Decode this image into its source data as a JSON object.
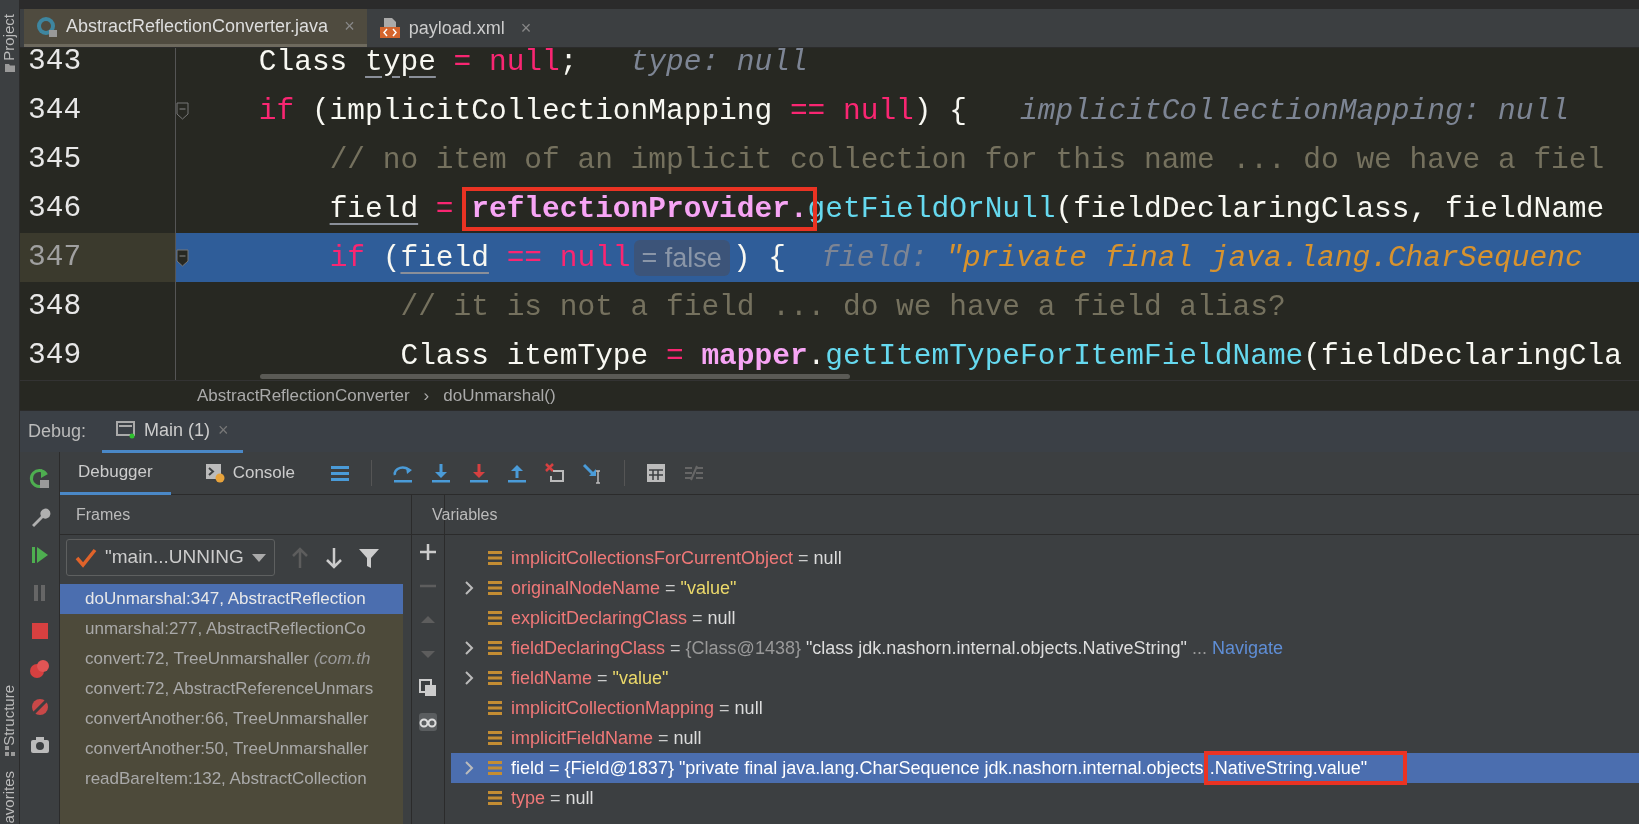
{
  "side_tabs": [
    {
      "label": "Project"
    },
    {
      "label": "Structure"
    },
    {
      "label": "avorites"
    }
  ],
  "editor_tabs": [
    {
      "label": "AbstractReflectionConverter.java",
      "kind": "java",
      "selected": true,
      "close": "×"
    },
    {
      "label": "payload.xml",
      "kind": "xml",
      "selected": false,
      "close": "×"
    }
  ],
  "code": {
    "lines": [
      {
        "number": "343",
        "current": false,
        "fold": false,
        "tokens": [
          {
            "text": "    Class ",
            "kind": "plain"
          },
          {
            "text": "type",
            "kind": "var"
          },
          {
            "text": " = ",
            "kind": "operator"
          },
          {
            "text": "null",
            "kind": "keyword"
          },
          {
            "text": ";   ",
            "kind": "plain"
          },
          {
            "text": "type: null",
            "kind": "hint"
          }
        ]
      },
      {
        "number": "344",
        "current": false,
        "fold": true,
        "tokens": [
          {
            "text": "    if",
            "kind": "keyword"
          },
          {
            "text": " (implicitCollectionMapping ",
            "kind": "plain"
          },
          {
            "text": "== ",
            "kind": "operator"
          },
          {
            "text": "null",
            "kind": "keyword"
          },
          {
            "text": ") {   ",
            "kind": "plain"
          },
          {
            "text": "implicitCollectionMapping: null",
            "kind": "hint"
          }
        ]
      },
      {
        "number": "345",
        "current": false,
        "fold": false,
        "tokens": [
          {
            "text": "        // no item of an implicit collection for this name ... do we have a fiel",
            "kind": "comment"
          }
        ]
      },
      {
        "number": "346",
        "current": false,
        "fold": false,
        "tokens": [
          {
            "text": "        field",
            "kind": "var"
          },
          {
            "text": " = ",
            "kind": "operator"
          },
          {
            "text": "reflectionProvider.",
            "kind": "member",
            "highlighted": true
          },
          {
            "text": "getFieldOrNull",
            "kind": "method"
          },
          {
            "text": "(fieldDeclaringClass, fieldName",
            "kind": "plain"
          }
        ]
      },
      {
        "number": "347",
        "current": true,
        "fold": true,
        "tokens": [
          {
            "text": "        if",
            "kind": "keyword"
          },
          {
            "text": " (",
            "kind": "plain"
          },
          {
            "text": "field",
            "kind": "var"
          },
          {
            "text": " == ",
            "kind": "operator"
          },
          {
            "text": "null",
            "kind": "keyword"
          },
          {
            "text": "= false",
            "kind": "inline_value"
          },
          {
            "text": ") {  ",
            "kind": "plain"
          },
          {
            "text": "field: ",
            "kind": "hint"
          },
          {
            "text": "\"private final java.lang.CharSequenc",
            "kind": "hint_value"
          }
        ]
      },
      {
        "number": "348",
        "current": false,
        "fold": false,
        "tokens": [
          {
            "text": "            // it is not a field ... do we have a field alias?",
            "kind": "comment"
          }
        ]
      },
      {
        "number": "349",
        "current": false,
        "fold": false,
        "tokens": [
          {
            "text": "            Class itemType ",
            "kind": "plain"
          },
          {
            "text": "= ",
            "kind": "operator"
          },
          {
            "text": "mapper",
            "kind": "member"
          },
          {
            "text": ".",
            "kind": "plain"
          },
          {
            "text": "getItemTypeForItemFieldName",
            "kind": "method"
          },
          {
            "text": "(fieldDeclaringCla",
            "kind": "plain"
          }
        ]
      }
    ]
  },
  "breadcrumb": {
    "items": [
      "AbstractReflectionConverter",
      "doUnmarshal()"
    ],
    "separator": "›"
  },
  "debug": {
    "label": "Debug:",
    "session_tab": {
      "label": "Main (1)",
      "close": "×"
    },
    "tabs": [
      {
        "label": "Debugger",
        "kind": "debugger",
        "selected": true
      },
      {
        "label": "Console",
        "kind": "console",
        "selected": false
      }
    ],
    "frames": {
      "title": "Frames",
      "thread": "\"main...UNNING",
      "items": [
        {
          "text": "doUnmarshal:347, AbstractReflection",
          "selected": true
        },
        {
          "text": "unmarshal:277, AbstractReflectionCo",
          "selected": false
        },
        {
          "text": "convert:72, TreeUnmarshaller",
          "detail": "(com.th",
          "selected": false
        },
        {
          "text": "convert:72, AbstractReferenceUnmars",
          "selected": false
        },
        {
          "text": "convertAnother:66, TreeUnmarshaller",
          "selected": false
        },
        {
          "text": "convertAnother:50, TreeUnmarshaller",
          "selected": false
        },
        {
          "text": "readBareItem:132, AbstractCollection",
          "selected": false
        }
      ]
    },
    "variables": {
      "title": "Variables",
      "items": [
        {
          "name": "implicitCollectionsForCurrentObject",
          "eq": "=",
          "expandable": false,
          "selected": false,
          "value": [
            {
              "text": "null",
              "kind": "null"
            }
          ]
        },
        {
          "name": "originalNodeName",
          "eq": "=",
          "expandable": true,
          "selected": false,
          "value": [
            {
              "text": "\"value\"",
              "kind": "string"
            }
          ]
        },
        {
          "name": "explicitDeclaringClass",
          "eq": "=",
          "expandable": false,
          "selected": false,
          "value": [
            {
              "text": "null",
              "kind": "null"
            }
          ]
        },
        {
          "name": "fieldDeclaringClass",
          "eq": "=",
          "expandable": true,
          "selected": false,
          "value": [
            {
              "text": "{Class@1438}",
              "kind": "ref"
            },
            {
              "text": "\"class jdk.nashorn.internal.objects.NativeString\"",
              "kind": "text"
            },
            {
              "text": "...",
              "kind": "ref"
            },
            {
              "text": "Navigate",
              "kind": "link"
            }
          ]
        },
        {
          "name": "fieldName",
          "eq": "=",
          "expandable": true,
          "selected": false,
          "value": [
            {
              "text": "\"value\"",
              "kind": "string"
            }
          ]
        },
        {
          "name": "implicitCollectionMapping",
          "eq": "=",
          "expandable": false,
          "selected": false,
          "value": [
            {
              "text": "null",
              "kind": "null"
            }
          ]
        },
        {
          "name": "implicitFieldName",
          "eq": "=",
          "expandable": false,
          "selected": false,
          "value": [
            {
              "text": "null",
              "kind": "null"
            }
          ]
        },
        {
          "name": "field",
          "eq": "=",
          "expandable": true,
          "selected": true,
          "value": [
            {
              "text": "{Field@1837}",
              "kind": "ref"
            },
            {
              "text": "\"private final java.lang.CharSequence jdk.nashorn.internal.objects",
              "kind": "text"
            },
            {
              "text": ".NativeString.value\"",
              "kind": "text",
              "highlighted": true
            }
          ]
        },
        {
          "name": "type",
          "eq": "=",
          "expandable": false,
          "selected": false,
          "value": [
            {
              "text": "null",
              "kind": "null"
            }
          ]
        }
      ]
    }
  }
}
